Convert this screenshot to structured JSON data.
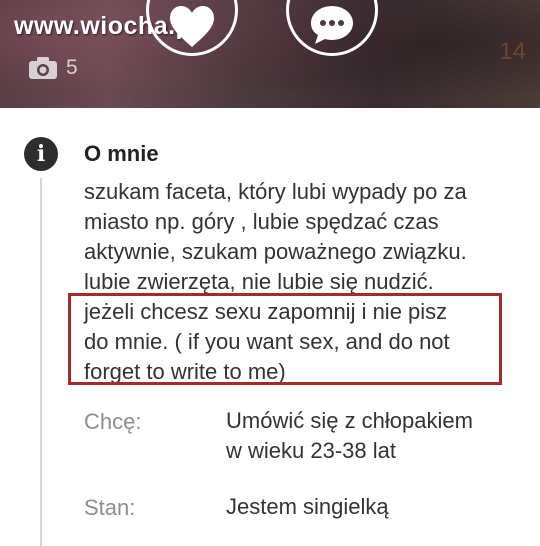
{
  "header": {
    "watermark": "www.wiocha.pl",
    "photo_count": "5",
    "corner_number": "14",
    "icons": {
      "camera": "camera-icon",
      "like": "heart-icon",
      "message": "chat-bubble-icon"
    }
  },
  "about": {
    "title": "O mnie",
    "lines": [
      "szukam faceta, który lubi wypady po za",
      "miasto np. góry , lubie spędzać czas",
      "aktywnie, szukam poważnego związku.",
      "lubie zwierzęta, nie lubie się nudzić.",
      "jeżeli chcesz sexu zapomnij i nie pisz",
      "do mnie. ( if you want sex, and do not",
      "forget to write to me)"
    ],
    "highlight_color": "#a52a2a"
  },
  "details": {
    "wants_label": "Chcę:",
    "wants_value_lines": [
      "Umówić się  z chłopakiem",
      "w wieku 23-38 lat"
    ],
    "status_label": "Stan:",
    "status_value": "Jestem singielką"
  }
}
